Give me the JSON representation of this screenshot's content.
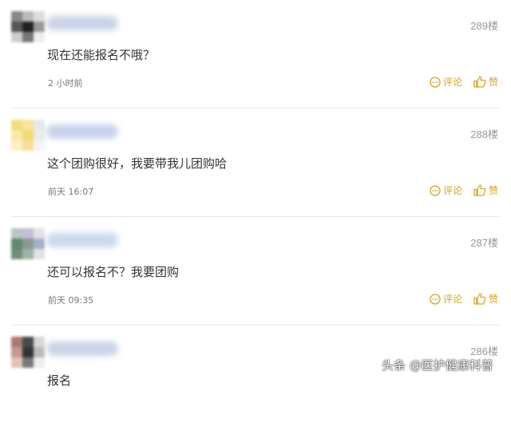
{
  "comments": [
    {
      "floor": "289楼",
      "text": "现在还能报名不哦？",
      "time": "2 小时前",
      "comment_label": "评论",
      "like_label": "赞",
      "avatar_colors": [
        "#888888",
        "#bbbbbb",
        "#dddddd",
        "#555555",
        "#222222",
        "#999999",
        "#cccccc",
        "#777777",
        "#eeeeee"
      ],
      "username_color": "#c9d3e6"
    },
    {
      "floor": "288楼",
      "text": "这个团购很好，我要带我儿团购哈",
      "time": "前天 16:07",
      "comment_label": "评论",
      "like_label": "赞",
      "avatar_colors": [
        "#f3dd7a",
        "#f6e59a",
        "#e8e8e8",
        "#f7e8a8",
        "#f2d97a",
        "#ececec",
        "#fbefc4",
        "#f5e09a",
        "#f4f4f4"
      ],
      "username_color": "#c7d2ea"
    },
    {
      "floor": "287楼",
      "text": "还可以报名不？我要团购",
      "time": "前天 09:35",
      "comment_label": "评论",
      "like_label": "赞",
      "avatar_colors": [
        "#b9c7c0",
        "#c7bdd6",
        "#e2e2e2",
        "#5e8a6e",
        "#8c9a8f",
        "#a2b0c8",
        "#6f8f78",
        "#9fb3a6",
        "#dfe4e0"
      ],
      "username_color": "#c9d8ec"
    },
    {
      "floor": "286楼",
      "text": "报名",
      "time": "",
      "comment_label": "",
      "like_label": "",
      "avatar_colors": [
        "#a87a6a",
        "#4a4a4a",
        "#d8d8d8",
        "#c49a8a",
        "#333333",
        "#bbbbbb",
        "#e0c4b8",
        "#777777",
        "#eeeeee"
      ],
      "username_color": "#c9d3e6"
    }
  ],
  "accent_color": "#d9a21b",
  "watermark": "头条 @医护健康科普"
}
